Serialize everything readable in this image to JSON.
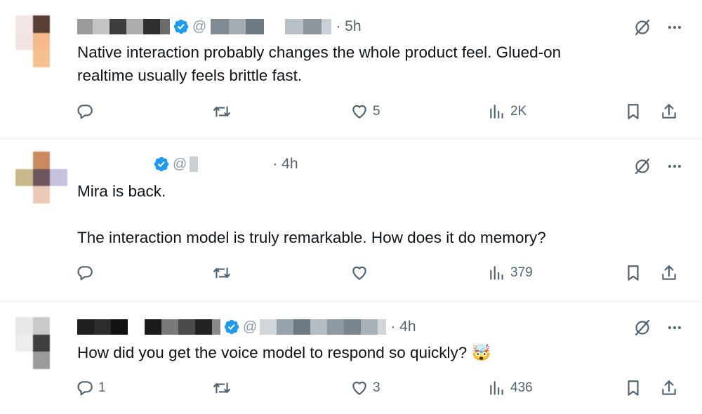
{
  "colors": {
    "text": "#0f1419",
    "secondary": "#536471",
    "verified": "#1d9bf0",
    "divider": "#eff3f4"
  },
  "icons": [
    "verified-badge-icon",
    "grok-icon",
    "more-icon",
    "reply-icon",
    "retweet-icon",
    "like-icon",
    "views-icon",
    "bookmark-icon",
    "share-icon"
  ],
  "tweets": [
    {
      "handle_prefix": "@",
      "time": "5h",
      "text": "Native interaction probably changes the whole product feel. Glued-on\nrealtime usually feels brittle fast.",
      "replies": "",
      "retweets": "",
      "likes": "5",
      "views": "2K"
    },
    {
      "handle_prefix": "@",
      "time": "4h",
      "text": "Mira is back.\n\nThe interaction model is truly remarkable. How does it do memory?",
      "replies": "",
      "retweets": "",
      "likes": "",
      "views": "379"
    },
    {
      "handle_prefix": "@",
      "time": "4h",
      "text": "How did you get the voice model to respond so quickly? 🤯",
      "replies": "1",
      "retweets": "",
      "likes": "3",
      "views": "436"
    }
  ]
}
